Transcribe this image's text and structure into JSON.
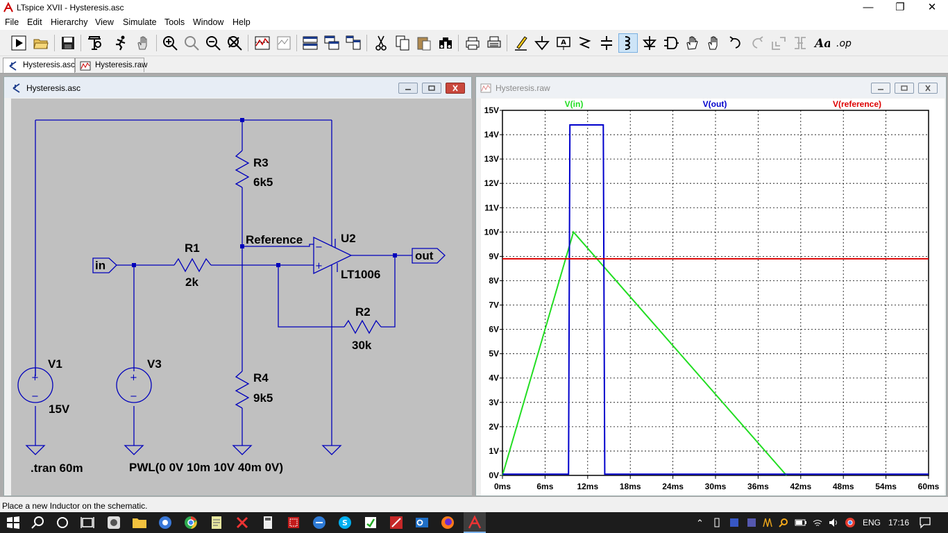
{
  "window": {
    "title": "LTspice XVII - Hysteresis.asc"
  },
  "menu": [
    "File",
    "Edit",
    "Hierarchy",
    "View",
    "Simulate",
    "Tools",
    "Window",
    "Help"
  ],
  "menu_underline": [
    "F",
    "E",
    "H",
    "V",
    "S",
    "T",
    "W",
    "H"
  ],
  "toolbar_icons": [
    "run-icon",
    "open-folder-icon",
    "save-icon",
    "control-panel-icon",
    "halt-icon",
    "pan-icon",
    "zoom-in-icon",
    "zoom-full-icon",
    "zoom-out-icon",
    "zoom-cancel-icon",
    "autorange-icon",
    "delete-plot-icon",
    "tile-horizontal-icon",
    "cascade-icon",
    "tile-icon",
    "cut-icon",
    "copy-icon",
    "paste-icon",
    "find-icon",
    "print-preview-icon",
    "print-icon",
    "draw-wire-icon",
    "ground-icon",
    "label-net-icon",
    "resistor-icon",
    "capacitor-icon",
    "inductor-icon",
    "diode-icon",
    "component-icon",
    "move-icon",
    "drag-icon",
    "undo-icon",
    "redo-icon",
    "rotate-icon",
    "mirror-icon",
    "text-icon",
    "spice-directive-icon"
  ],
  "tabs": [
    {
      "label": "Hysteresis.asc",
      "active": true,
      "icon": "schematic-icon"
    },
    {
      "label": "Hysteresis.raw",
      "active": false,
      "icon": "waveform-icon"
    }
  ],
  "schematic_window": {
    "title": "Hysteresis.asc",
    "labels": {
      "r3_name": "R3",
      "r3_value": "6k5",
      "r1_name": "R1",
      "r1_value": "2k",
      "r2_name": "R2",
      "r2_value": "30k",
      "r4_name": "R4",
      "r4_value": "9k5",
      "u2_name": "U2",
      "u2_model": "LT1006",
      "v1_name": "V1",
      "v1_value": "15V",
      "v3_name": "V3",
      "v3_value": "PWL(0 0V 10m 10V 40m 0V)",
      "net_reference": "Reference",
      "port_in": "in",
      "port_out": "out",
      "directive": ".tran 60m",
      "opamp_minus": "−",
      "opamp_plus": "+",
      "src_plus": "+",
      "src_minus": "−"
    }
  },
  "plot_window": {
    "title": "Hysteresis.raw",
    "colors": {
      "vin": "#22dd22",
      "vout": "#0000cc",
      "vref": "#dd0000",
      "axis": "#000000",
      "grid": "#000000"
    },
    "chart_data": {
      "type": "line",
      "title": "",
      "xlabel": "",
      "ylabel": "",
      "xlim": [
        0,
        60
      ],
      "ylim": [
        0,
        15
      ],
      "grid": true,
      "legend": "top",
      "x_ticks": [
        "0ms",
        "6ms",
        "12ms",
        "18ms",
        "24ms",
        "30ms",
        "36ms",
        "42ms",
        "48ms",
        "54ms",
        "60ms"
      ],
      "y_ticks": [
        "0V",
        "1V",
        "2V",
        "3V",
        "4V",
        "5V",
        "6V",
        "7V",
        "8V",
        "9V",
        "10V",
        "11V",
        "12V",
        "13V",
        "14V",
        "15V"
      ],
      "series": [
        {
          "name": "V(in)",
          "color": "#22dd22",
          "x": [
            0,
            10,
            40
          ],
          "y": [
            0,
            10,
            0
          ]
        },
        {
          "name": "V(out)",
          "color": "#0000cc",
          "x": [
            0,
            9.3,
            9.5,
            14.2,
            14.4,
            60
          ],
          "y": [
            0.05,
            0.05,
            14.4,
            14.4,
            0.05,
            0.05
          ]
        },
        {
          "name": "V(reference)",
          "color": "#dd0000",
          "x": [
            0,
            60
          ],
          "y": [
            8.9,
            8.9
          ]
        }
      ]
    }
  },
  "status": {
    "text": "Place a new Inductor on the schematic."
  },
  "taskbar": {
    "apps": [
      "windows-start-icon",
      "search-icon",
      "cortana-icon",
      "task-view-icon",
      "app-icon",
      "file-explorer-icon",
      "browser-icon",
      "chrome-icon",
      "notepad-icon",
      "x-app-icon",
      "calculator-icon",
      "red-app-icon",
      "blue-app-icon",
      "skype-icon",
      "green-app-icon",
      "red-tool-icon",
      "outlook-icon",
      "firefox-icon",
      "ltspice-icon"
    ],
    "lang": "ENG",
    "time": "17:16"
  }
}
